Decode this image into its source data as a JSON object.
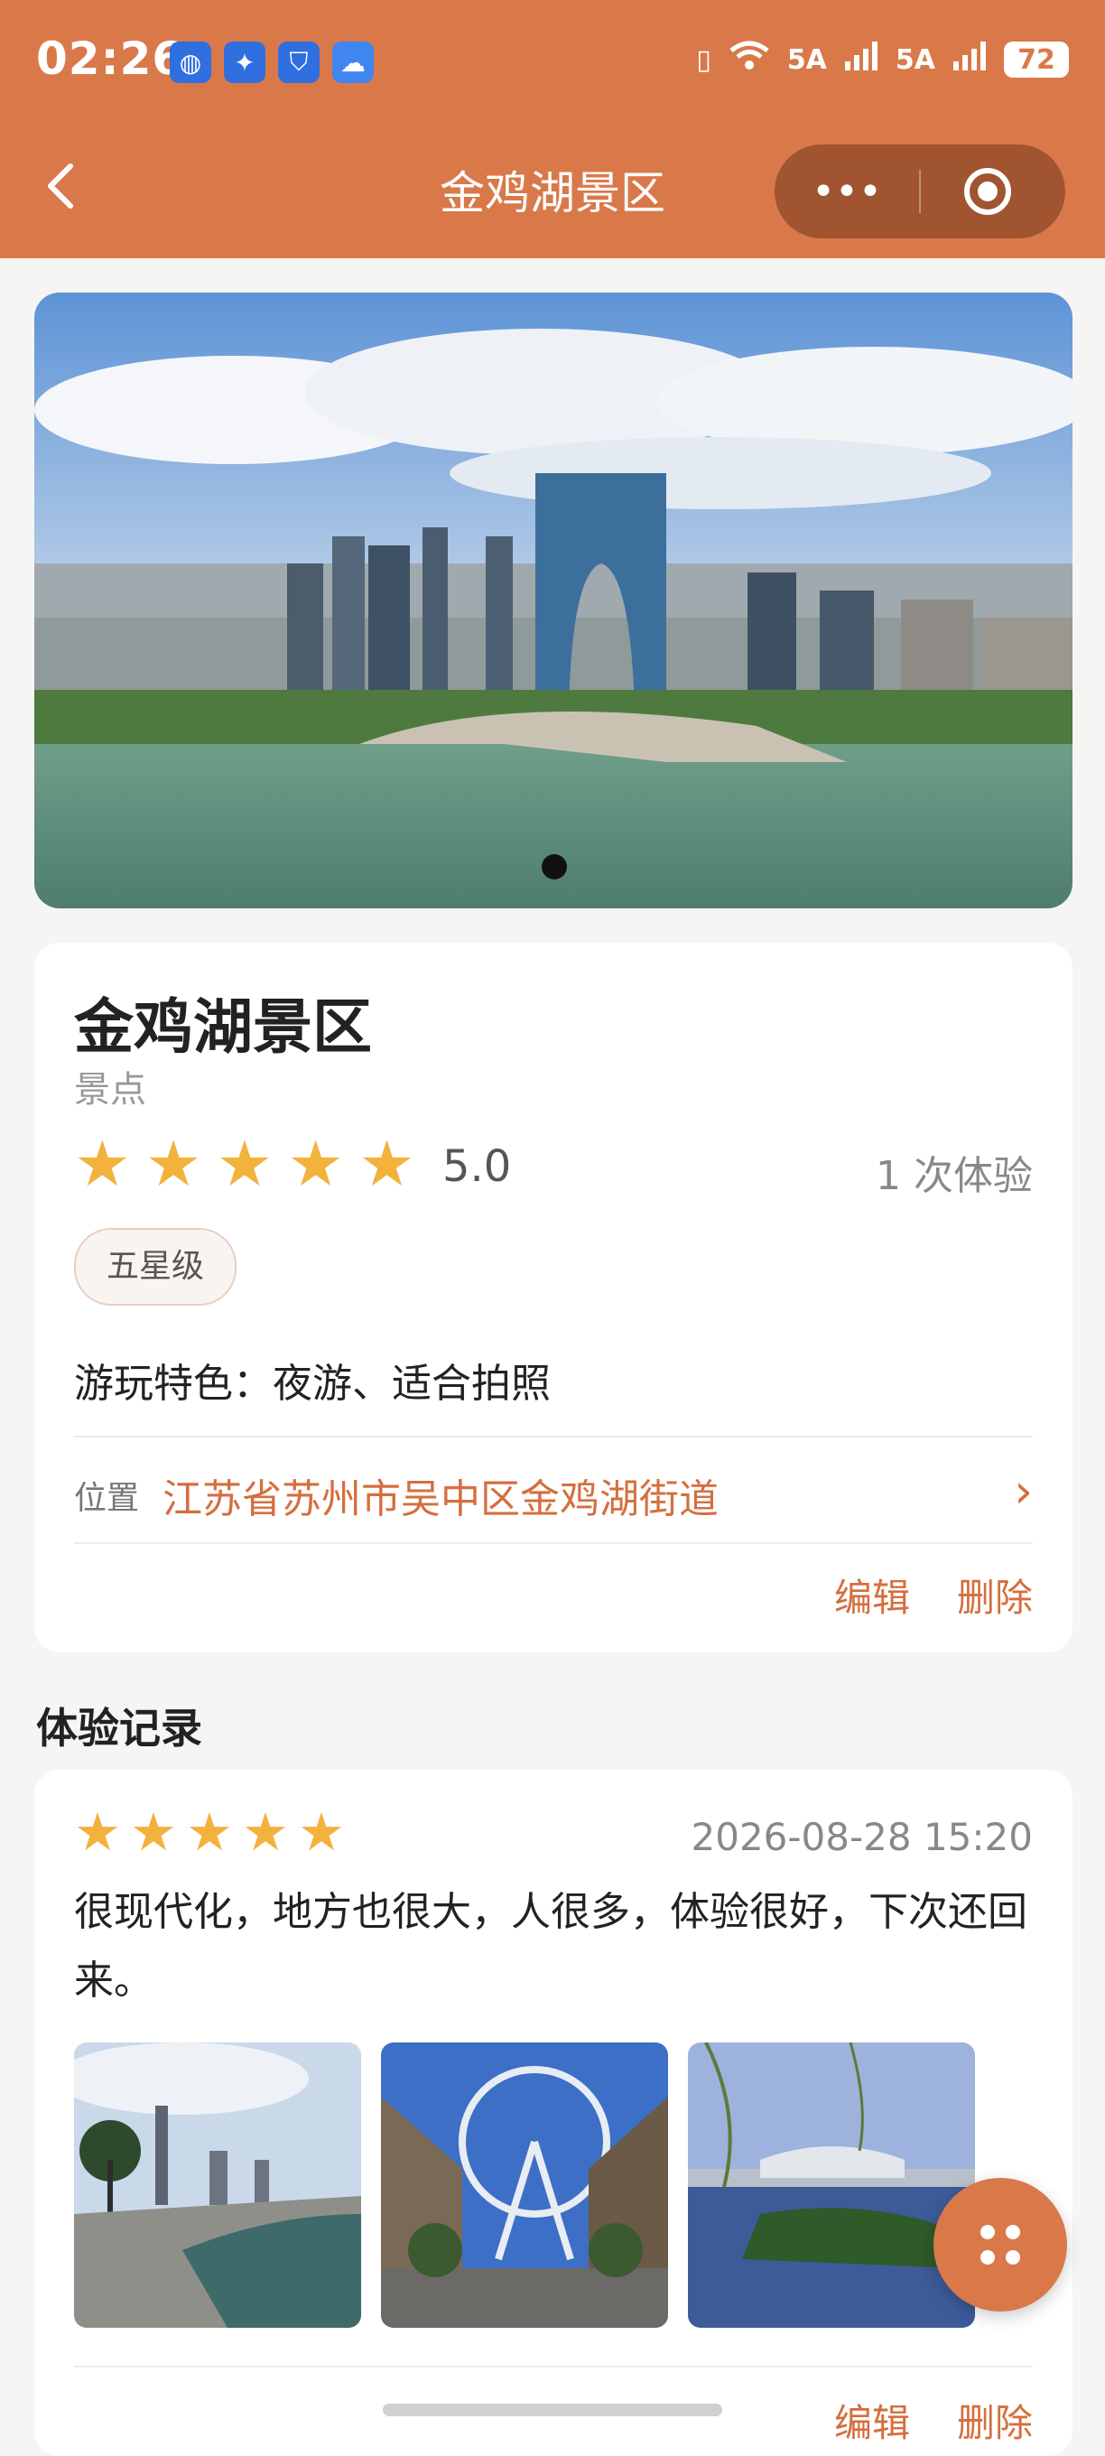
{
  "status_bar": {
    "time": "02:26",
    "battery": "72",
    "network_1": "5A",
    "network_2": "5A",
    "app_icons": [
      "globe-icon",
      "lightbulb-icon",
      "shield-icon",
      "cloud-icon"
    ]
  },
  "navbar": {
    "title": "金鸡湖景区",
    "back_icon": "back-chevron-icon",
    "more_icon": "more-dots-icon",
    "close_icon": "target-close-icon"
  },
  "banner": {
    "image": "city skyline over lake (Gate to the East)",
    "page_indicator": "1 of 1"
  },
  "info": {
    "title": "金鸡湖景区",
    "category": "景点",
    "stars": 5,
    "rating": "5.0",
    "experience_count": "1 次体验",
    "tag": "五星级",
    "features": "游玩特色：夜游、适合拍照",
    "location_label": "位置",
    "location_value": "江苏省苏州市吴中区金鸡湖街道",
    "edit": "编辑",
    "delete": "删除"
  },
  "records_section": {
    "title": "体验记录",
    "records": [
      {
        "stars": 5,
        "date": "2026-08-28 15:20",
        "text": "很现代化，地方也很大，人很多，体验很好，下次还回来。",
        "photos": [
          "lakeside promenade",
          "ferris wheel plaza",
          "lake with reeds"
        ],
        "edit": "编辑",
        "delete": "删除"
      }
    ]
  },
  "colors": {
    "brand": "#d9794a",
    "accent_text": "#d56e3e",
    "star": "#f3b23c",
    "background": "#f6f5f3"
  },
  "fab_icon": "grid-dots-icon"
}
